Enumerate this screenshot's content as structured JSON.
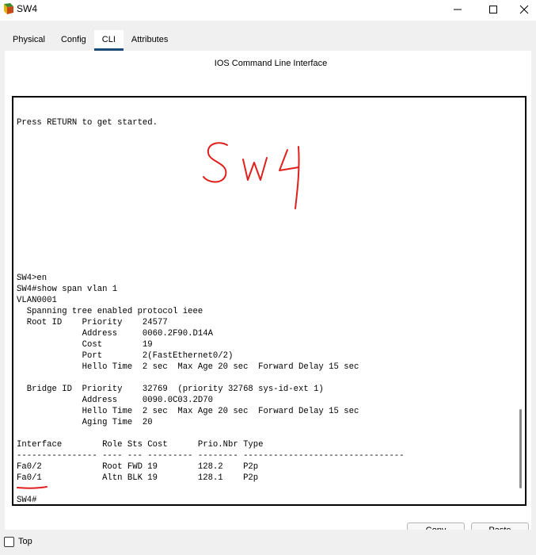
{
  "window": {
    "title": "SW4",
    "icon": "packet-tracer-switch-icon",
    "controls": {
      "minimize": "minimize-icon",
      "maximize": "maximize-icon",
      "close": "close-icon"
    }
  },
  "tabs": [
    {
      "label": "Physical",
      "active": false
    },
    {
      "label": "Config",
      "active": false
    },
    {
      "label": "CLI",
      "active": true
    },
    {
      "label": "Attributes",
      "active": false
    }
  ],
  "cli": {
    "header": "IOS Command Line Interface",
    "handwritten_note": "SW4",
    "terminal_lines": [
      "Press RETURN to get started.",
      "",
      "",
      "",
      "",
      "",
      "",
      "",
      "",
      "",
      "",
      "",
      "",
      "",
      "SW4>en",
      "SW4#show span vlan 1",
      "VLAN0001",
      "  Spanning tree enabled protocol ieee",
      "  Root ID    Priority    24577",
      "             Address     0060.2F90.D14A",
      "             Cost        19",
      "             Port        2(FastEthernet0/2)",
      "             Hello Time  2 sec  Max Age 20 sec  Forward Delay 15 sec",
      "",
      "  Bridge ID  Priority    32769  (priority 32768 sys-id-ext 1)",
      "             Address     0090.0C03.2D70",
      "             Hello Time  2 sec  Max Age 20 sec  Forward Delay 15 sec",
      "             Aging Time  20",
      "",
      "Interface        Role Sts Cost      Prio.Nbr Type",
      "---------------- ---- --- --------- -------- --------------------------------",
      "Fa0/2            Root FWD 19        128.2    P2p",
      "Fa0/1            Altn BLK 19        128.1    P2p",
      "",
      "SW4#"
    ],
    "annotation_color": "#e0201c"
  },
  "buttons": {
    "copy": "Copy",
    "paste": "Paste"
  },
  "footer": {
    "top_label": "Top",
    "top_checked": false
  },
  "colors": {
    "tab_active_underline": "#1a4b76",
    "panel_bg": "#f0f0f0"
  }
}
